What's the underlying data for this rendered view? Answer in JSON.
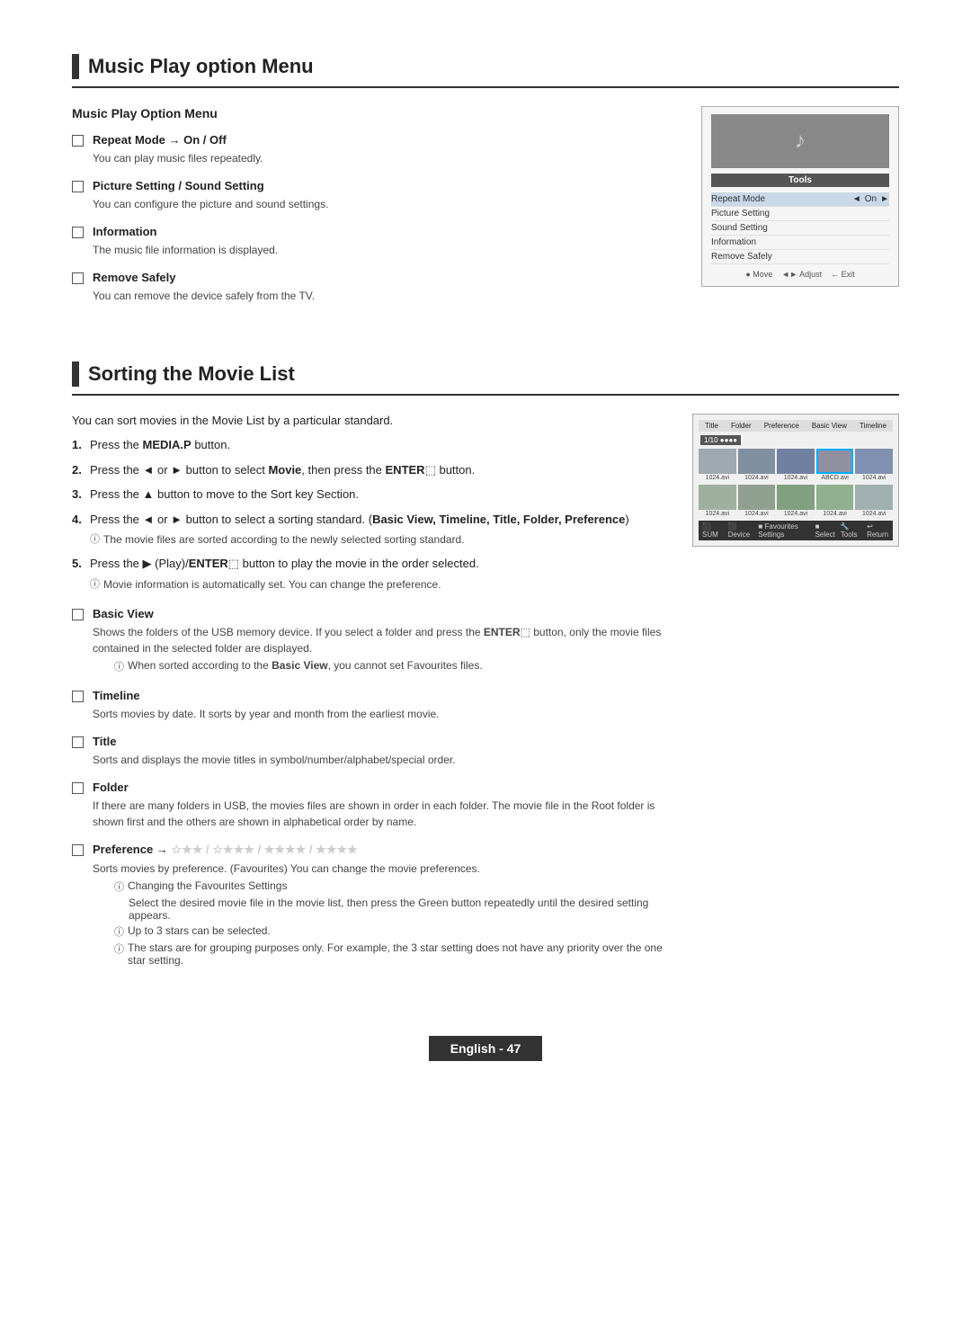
{
  "page": {
    "section1": {
      "title": "Music Play option Menu",
      "sub_heading": "Music Play Option Menu",
      "items": [
        {
          "title": "Repeat Mode → On / Off",
          "desc": "You can play music files repeatedly."
        },
        {
          "title": "Picture Setting / Sound Setting",
          "desc": "You can configure the picture and sound settings."
        },
        {
          "title": "Information",
          "desc": "The music file information is displayed."
        },
        {
          "title": "Remove Safely",
          "desc": "You can remove the device safely from the TV."
        }
      ],
      "tools_panel": {
        "title": "Tools",
        "rows": [
          {
            "label": "Repeat Mode",
            "value": "On",
            "highlight": true
          },
          {
            "label": "Picture Setting",
            "value": ""
          },
          {
            "label": "Sound Setting",
            "value": ""
          },
          {
            "label": "Information",
            "value": ""
          },
          {
            "label": "Remove Safely",
            "value": ""
          }
        ],
        "footer": "● Move  ◄► Adjust  ← Exit"
      }
    },
    "section2": {
      "title": "Sorting the Movie List",
      "intro": "You can sort movies in the Movie List by a particular standard.",
      "steps": [
        {
          "num": "1.",
          "text": "Press the MEDIA.P button."
        },
        {
          "num": "2.",
          "text": "Press the ◄ or ► button to select Movie, then press the ENTER button."
        },
        {
          "num": "3.",
          "text": "Press the ▲ button to move to the Sort key Section."
        },
        {
          "num": "4.",
          "text": "Press the ◄ or ► button to select a sorting standard. (Basic View, Timeline, Title, Folder, Preference)",
          "note": "The movie files are sorted according to the newly selected sorting standard."
        },
        {
          "num": "5.",
          "text": "Press the (Play)/ENTER button to play the movie in the order selected.",
          "note": "Movie information is automatically set. You can change the preference."
        }
      ],
      "checkboxItems": [
        {
          "title": "Basic View",
          "desc": "Shows the folders of the USB memory device. If you select a folder and press the ENTER button, only the movie files contained in the selected folder are displayed.",
          "note": "When sorted according to the Basic View, you cannot set Favourites files."
        },
        {
          "title": "Timeline",
          "desc": "Sorts movies by date. It sorts by year and month from the earliest movie.",
          "note": null
        },
        {
          "title": "Title",
          "desc": "Sorts and displays the movie titles in symbol/number/alphabet/special order.",
          "note": null
        },
        {
          "title": "Folder",
          "desc": "If there are many folders in USB, the movies files are shown in order in each folder. The movie file in the Root folder is shown first and the others are shown in alphabetical order by name.",
          "note": null
        },
        {
          "title": "Preference → ☆★★ / ☆★★★ / ★★★★ / ★★★★",
          "desc": "Sorts movies by preference. (Favourites) You can change the movie preferences.",
          "notes": [
            "Changing the Favourites Settings\n          Select the desired movie file in the movie list, then press the Green button repeatedly until the desired setting appears.",
            "Up to 3 stars can be selected.",
            "The stars are for grouping purposes only. For example, the 3 star setting does not have any priority over the one star setting."
          ]
        }
      ]
    },
    "footer": {
      "label": "English - 47"
    }
  }
}
